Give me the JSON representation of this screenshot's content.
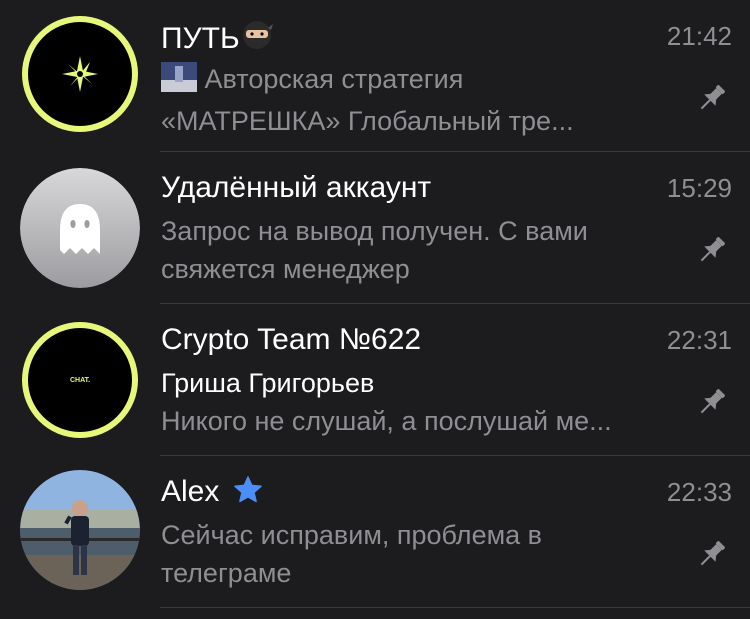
{
  "chats": [
    {
      "title": "ПУТЬ",
      "time": "21:42",
      "preview_line1": "Авторская стратегия",
      "preview_line2": "«МАТРЕШКА»  Глобальный тре...",
      "pinned": true
    },
    {
      "title": "Удалённый аккаунт",
      "time": "15:29",
      "preview_line1": "Запрос на вывод получен. С вами",
      "preview_line2": "свяжется менеджер",
      "pinned": true
    },
    {
      "title": "Crypto Team №622",
      "time": "22:31",
      "sender": "Гриша Григорьев",
      "preview_line2": "Никого не слушай, а послушай ме...",
      "avatar_text": "CHAT.",
      "pinned": true
    },
    {
      "title": "Alex",
      "time": "22:33",
      "preview_line1": "Сейчас исправим, проблема в",
      "preview_line2": "телеграме",
      "pinned": true
    }
  ],
  "colors": {
    "background": "#1c1c1e",
    "ring": "#e6f77a",
    "secondary_text": "#8e8e93",
    "star": "#4c8ef7"
  }
}
